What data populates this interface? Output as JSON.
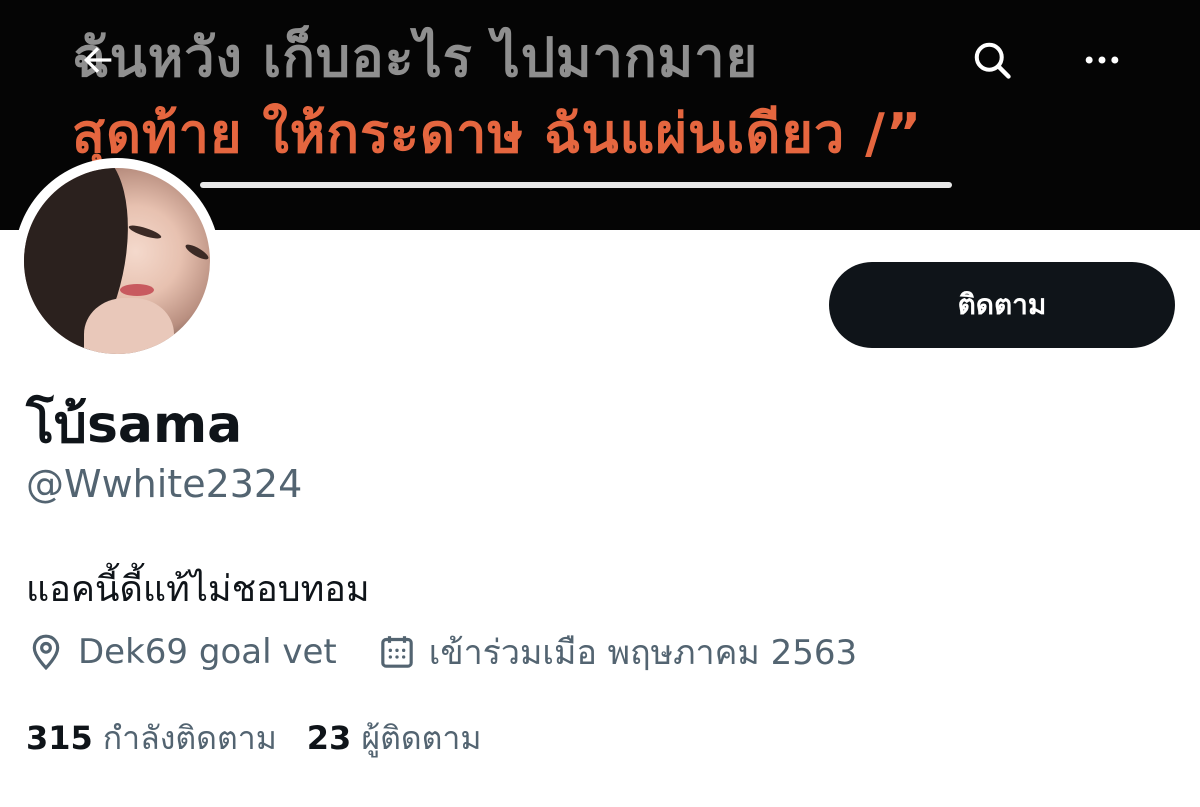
{
  "banner": {
    "line1": "ฉันหวัง เก็บอะไร ไปมากมาย",
    "line2": "สุดท้าย ให้กระดาษ ฉันแผ่นเดียว /”",
    "line1_color": "#8f8f8f",
    "line2_color": "#e5663f"
  },
  "header": {
    "back_icon": "arrow-left-icon",
    "search_icon": "search-icon",
    "more_icon": "more-horizontal-icon"
  },
  "profile": {
    "display_name": "โบ้sama",
    "handle": "@Wwhite2324",
    "bio": "แอคนี้ดี้แท้ไม่ชอบทอม",
    "location": "Dek69 goal vet",
    "joined": "เข้าร่วมเมือ พฤษภาคม 2563",
    "location_icon": "location-pin-icon",
    "joined_icon": "calendar-icon"
  },
  "follow_button": {
    "label": "ติดตาม"
  },
  "stats": {
    "following_count": "315",
    "following_label": "กำลังติดตาม",
    "followers_count": "23",
    "followers_label": "ผู้ติดตาม"
  },
  "colors": {
    "text_primary": "#0f1419",
    "text_secondary": "#536471",
    "button_bg": "#0f1419",
    "banner_bg": "#050505"
  }
}
